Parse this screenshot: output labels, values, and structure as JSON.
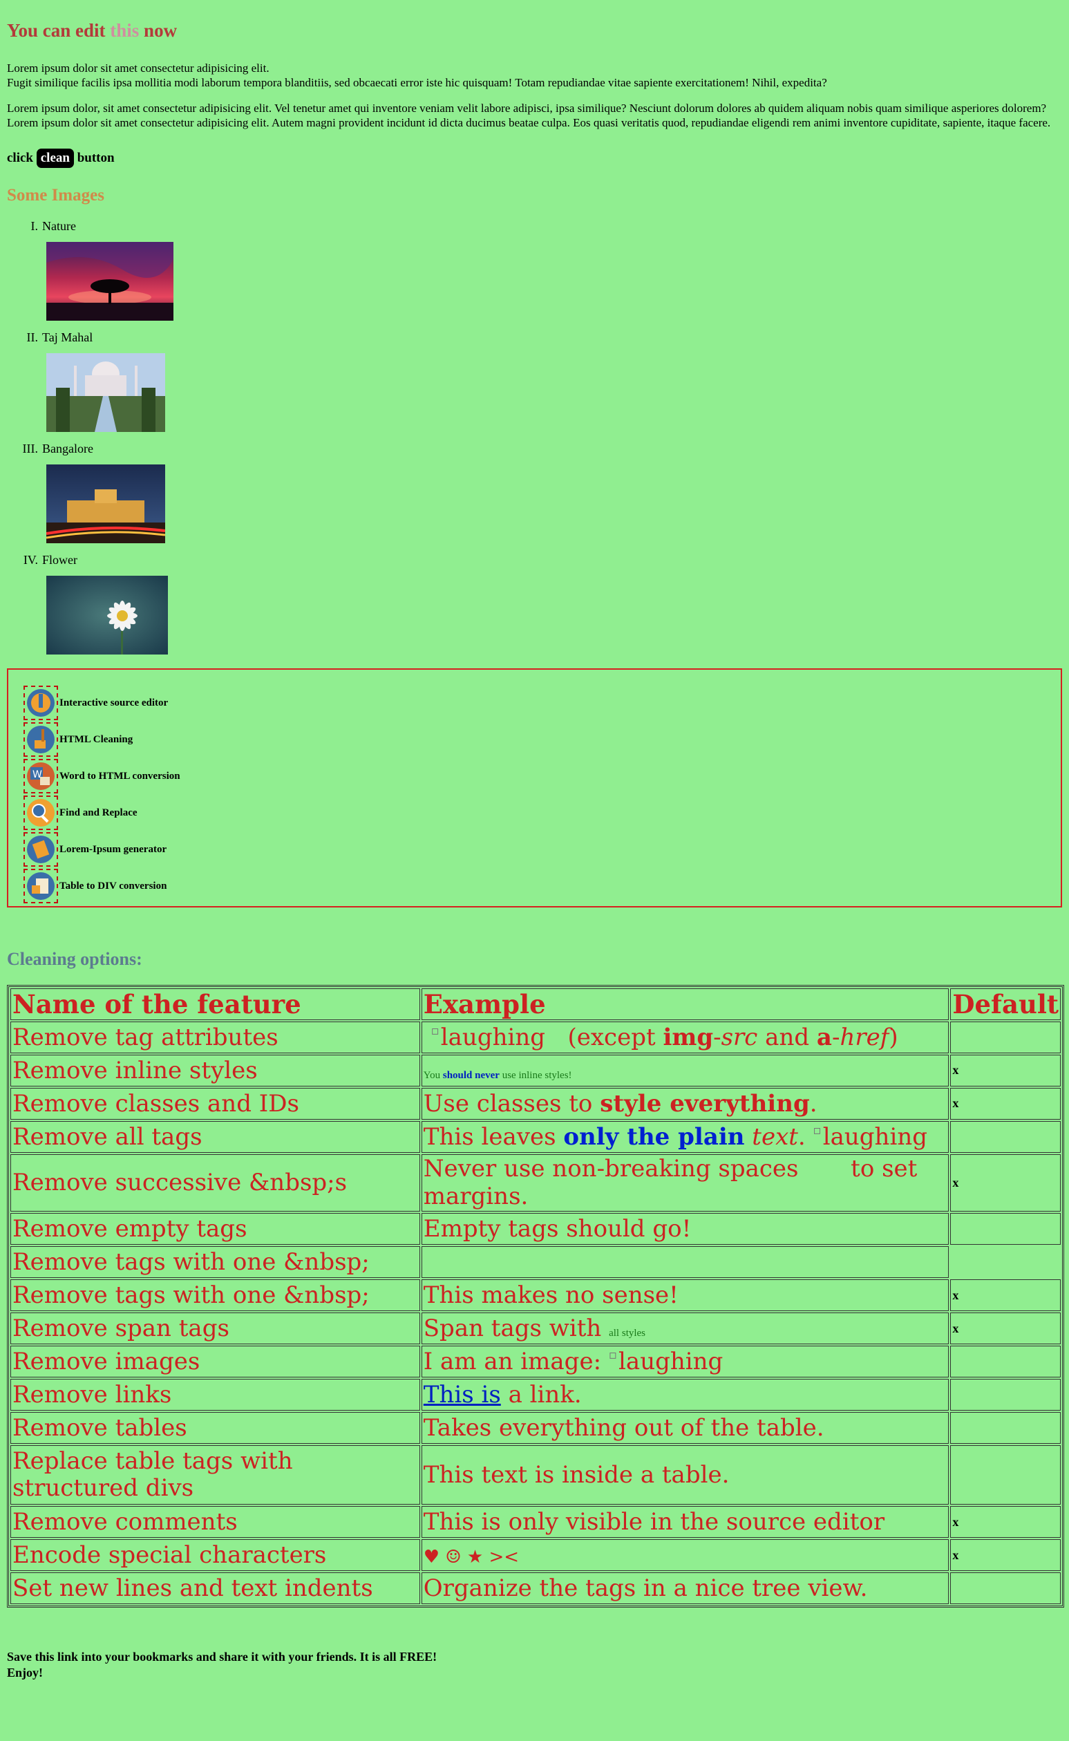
{
  "heading": {
    "part1": "You can edit ",
    "part2": "this",
    "part3": " now"
  },
  "paragraphs": [
    "Lorem ipsum dolor sit amet consectetur adipisicing elit.",
    "Fugit similique facilis ipsa mollitia modi laborum tempora blanditiis, sed obcaecati error iste hic quisquam! Totam repudiandae vitae sapiente exercitationem! Nihil, expedita?",
    "Lorem ipsum dolor, sit amet consectetur adipisicing elit. Vel tenetur amet qui inventore veniam velit labore adipisci, ipsa similique? Nesciunt dolorum dolores ab quidem aliquam nobis quam similique asperiores dolorem?  Lorem ipsum dolor sit amet consectetur adipisicing elit. Autem magni provident incidunt id dicta ducimus beatae culpa. Eos quasi veritatis quod, repudiandae eligendi rem animi inventore cupiditate, sapiente, itaque facere."
  ],
  "clickline": {
    "pre": "click ",
    "button": "clean",
    "post": " button"
  },
  "images_heading": "Some Images",
  "images": [
    {
      "num": "I.",
      "label": "Nature",
      "icon": "tree-sunset-image"
    },
    {
      "num": "II.",
      "label": "Taj Mahal",
      "icon": "taj-mahal-image"
    },
    {
      "num": "III.",
      "label": "Bangalore",
      "icon": "bangalore-palace-image"
    },
    {
      "num": "IV.",
      "label": "Flower",
      "icon": "daisy-flower-image"
    }
  ],
  "features": [
    {
      "label": "Interactive source editor",
      "icon": "editor-icon"
    },
    {
      "label": "HTML Cleaning",
      "icon": "broom-icon"
    },
    {
      "label": "Word to HTML conversion",
      "icon": "word-icon"
    },
    {
      "label": "Find and Replace",
      "icon": "magnifier-icon"
    },
    {
      "label": "Lorem-Ipsum generator",
      "icon": "text-generator-icon"
    },
    {
      "label": "Table to DIV conversion",
      "icon": "table-icon"
    }
  ],
  "cleaning_heading": "Cleaning options:",
  "table": {
    "headers": [
      "Name of the feature",
      "Example",
      "Default"
    ],
    "rows": [
      {
        "name": "Remove tag attributes",
        "default": ""
      },
      {
        "name": "Remove inline styles",
        "default": "x"
      },
      {
        "name": "Remove classes and IDs",
        "default": "x"
      },
      {
        "name": "Remove all tags",
        "default": ""
      },
      {
        "name": "Remove successive &nbsp;s",
        "default": "x"
      },
      {
        "name": "Remove empty tags",
        "default": ""
      },
      {
        "name": "Remove tags with one &nbsp;",
        "default": ""
      },
      {
        "name": "Remove tags with one &nbsp;",
        "default": "x"
      },
      {
        "name": "Remove span tags",
        "default": "x"
      },
      {
        "name": "Remove images",
        "default": ""
      },
      {
        "name": "Remove links",
        "default": ""
      },
      {
        "name": "Remove tables",
        "default": ""
      },
      {
        "name": "Replace table tags with structured divs",
        "default": ""
      },
      {
        "name": "Remove comments",
        "default": "x"
      },
      {
        "name": "Encode special characters",
        "default": "x"
      },
      {
        "name": "Set new lines and text indents",
        "default": ""
      }
    ],
    "ex": {
      "r0": {
        "alt": "laughing",
        "a": "(except ",
        "b": "img",
        "c": "-",
        "d": "src",
        "e": " and ",
        "f": "a",
        "g": "-",
        "h": "href",
        "i": ")"
      },
      "r1": {
        "a": "You ",
        "b": "should never",
        "c": " use inline styles!"
      },
      "r2": {
        "a": "Use classes to ",
        "b": "style everything",
        "c": "."
      },
      "r3": {
        "a": "This leaves ",
        "b": "only the plain",
        "c": " ",
        "d": "text",
        "e": ". ",
        "alt": "laughing"
      },
      "r4": {
        "a": "Never use non-breaking spaces       to set margins."
      },
      "r5": {
        "a": "Empty tags should go!"
      },
      "r7": {
        "a": "This makes no sense!"
      },
      "r8": {
        "a": "Span tags with ",
        "b": "all styles"
      },
      "r9": {
        "a": "I am an image: ",
        "alt": "laughing"
      },
      "r10": {
        "a": "This is",
        "b": " a link."
      },
      "r11": {
        "a": "Takes everything out of the table."
      },
      "r12": {
        "a": "This text is inside a table."
      },
      "r13": {
        "a": "This is only visible in the source editor"
      },
      "r14": {
        "a": "♥ ☺ ★ ><"
      },
      "r15": {
        "a": "Organize the tags in a nice tree view."
      }
    }
  },
  "footer": {
    "line1": "Save this link into your bookmarks and share it with your friends. It is all FREE!",
    "line2": "Enjoy!"
  }
}
